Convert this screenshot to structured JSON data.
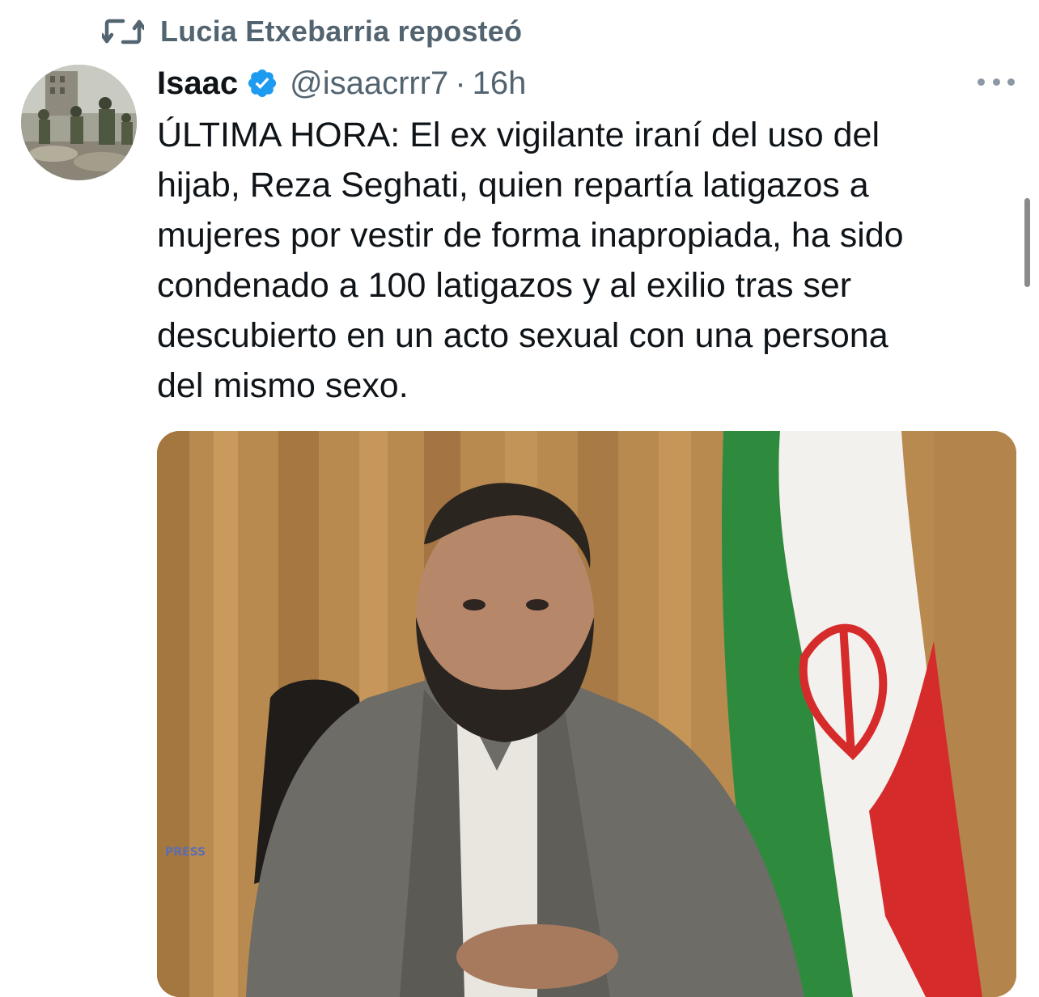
{
  "repost": {
    "icon": "repost-icon",
    "text": "Lucia Etxebarria reposteó"
  },
  "author": {
    "name": "Isaac",
    "verified_icon": "verified-badge-icon",
    "handle": "@isaacrrr7",
    "separator": "·",
    "time": "16h"
  },
  "tweet": {
    "text": "ÚLTIMA HORA: El ex vigilante iraní del uso del\nhijab, Reza Seghati, quien repartía latigazos a\nmujeres por vestir de forma inapropiada, ha sido\ncondenado a 100 latigazos y al exilio tras ser\ndescubierto en un acto sexual con una persona\ndel mismo sexo."
  },
  "media": {
    "watermark": "PRESS"
  },
  "colors": {
    "text_primary": "#0f1419",
    "text_secondary": "#536471",
    "verified_blue": "#1d9bf0",
    "more_dots": "#8b98a5"
  },
  "icons": {
    "more": "more-options-icon"
  }
}
